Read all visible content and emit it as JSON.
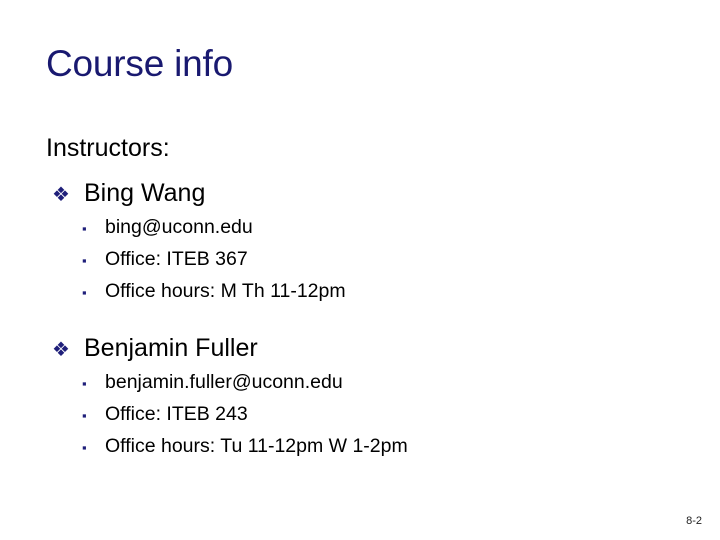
{
  "slide": {
    "title": "Course info",
    "lead": "Instructors:",
    "page_number": "8-2",
    "colors": {
      "title": "#191970",
      "bullet": "#1f1f7a",
      "body_text": "#000000",
      "background": "#ffffff"
    },
    "markers": {
      "level1": "❖",
      "level1_name": "diamond-bullet-icon",
      "level2": "▪",
      "level2_name": "square-bullet-icon"
    },
    "instructors": [
      {
        "name": "Bing Wang",
        "details": [
          "bing@uconn.edu",
          "Office: ITEB 367",
          "Office hours: M Th 11-12pm"
        ]
      },
      {
        "name": "Benjamin Fuller",
        "details": [
          "benjamin.fuller@uconn.edu",
          "Office: ITEB 243",
          "Office hours: Tu 11-12pm W 1-2pm"
        ]
      }
    ]
  }
}
